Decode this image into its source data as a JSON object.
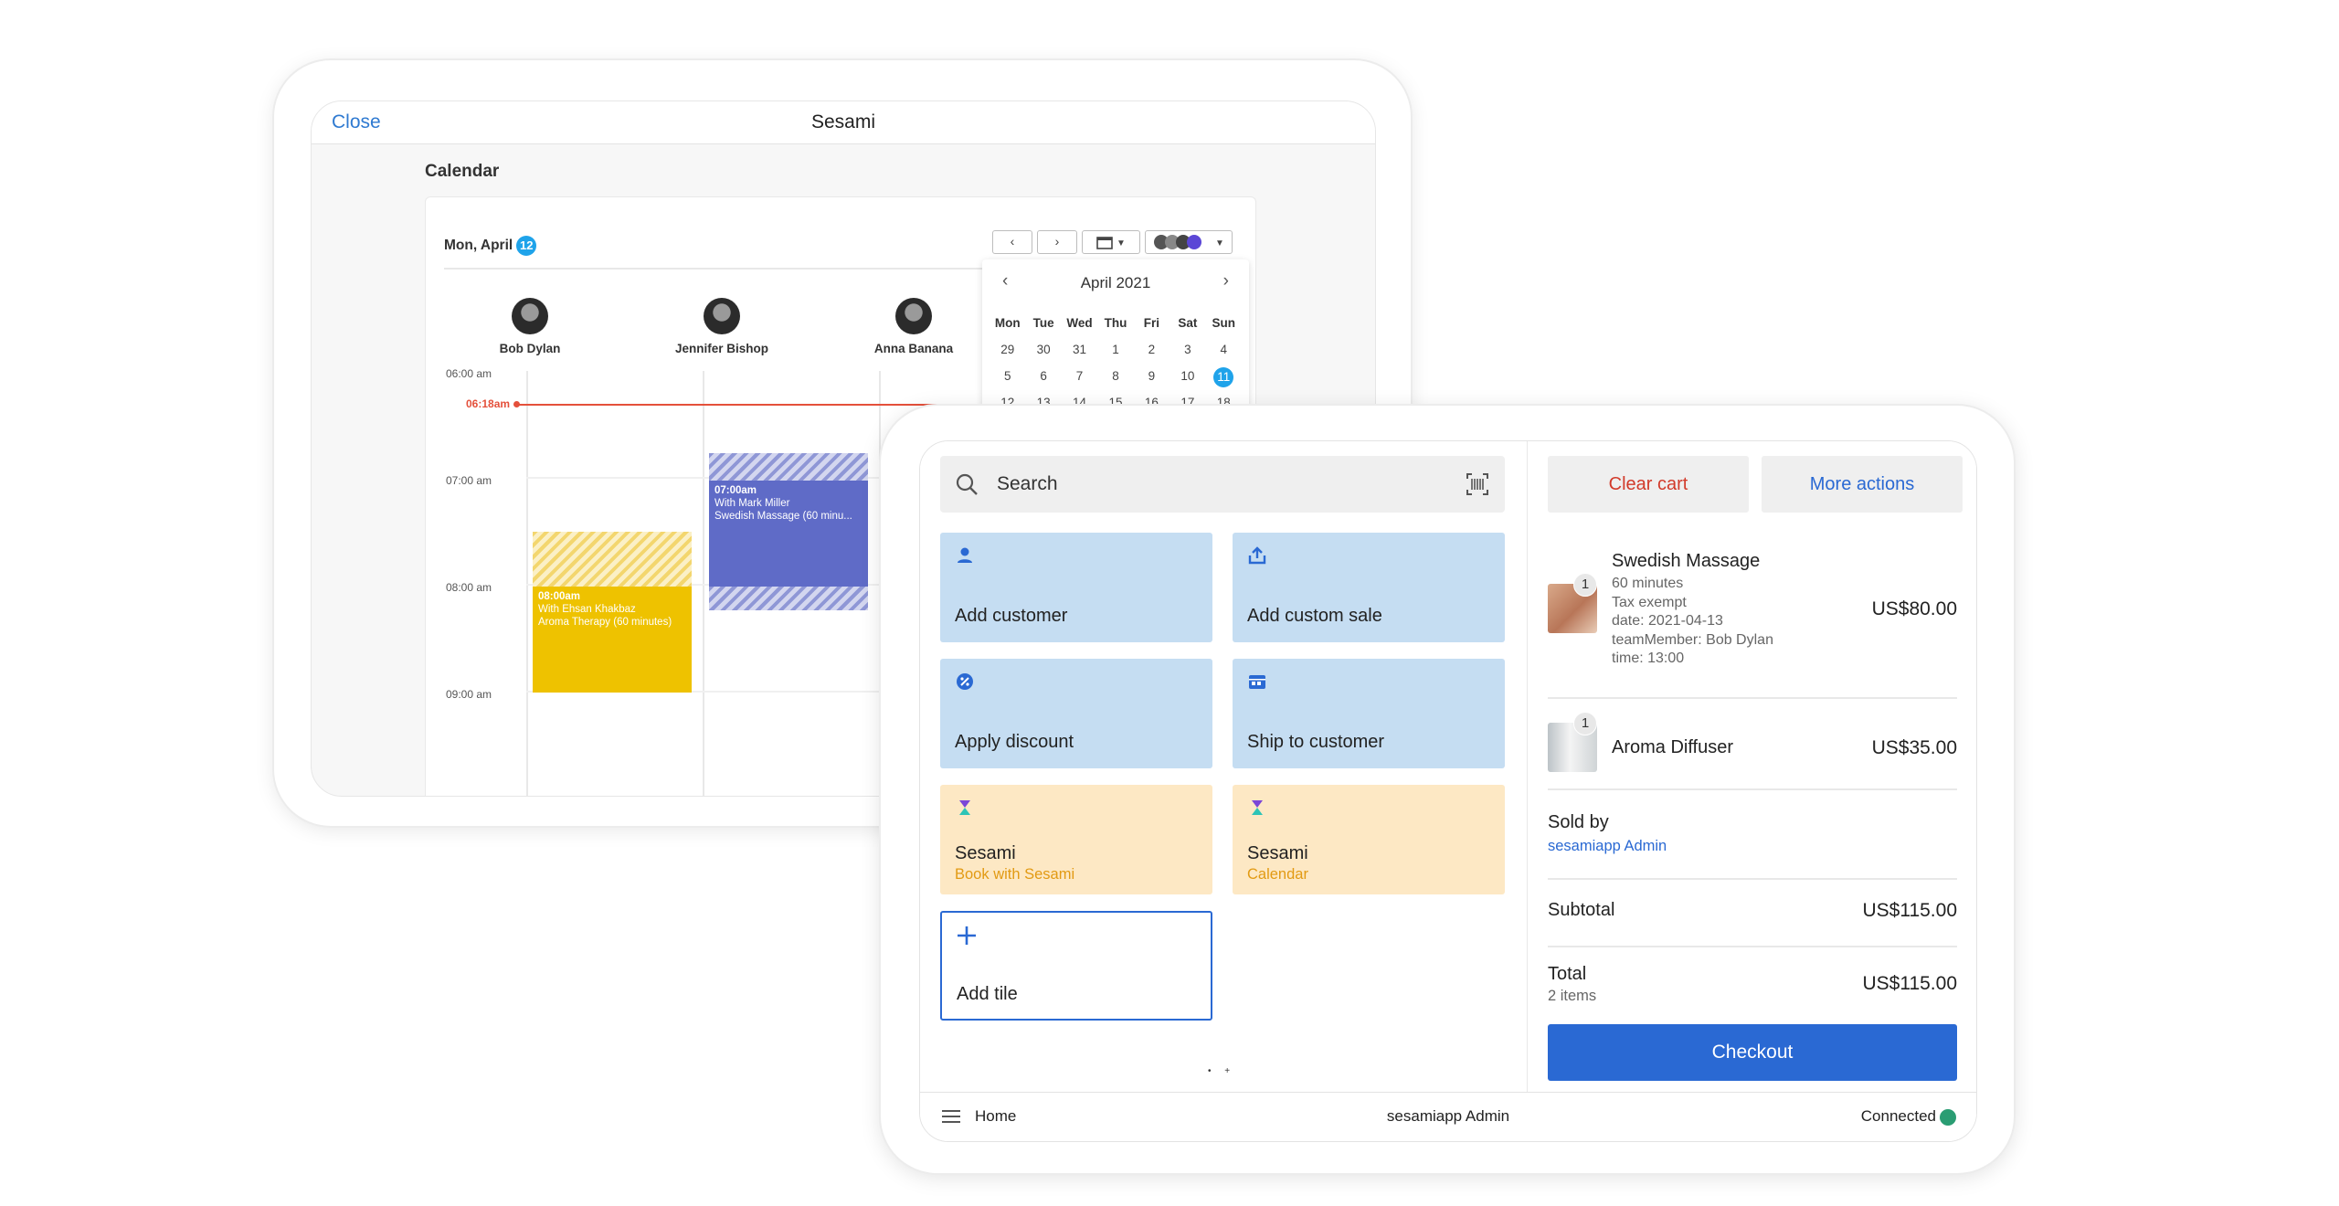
{
  "calendar_app": {
    "close_label": "Close",
    "title": "Sesami",
    "heading": "Calendar",
    "date_label": "Mon, April",
    "date_badge": "12",
    "staff": [
      {
        "name": "Bob Dylan"
      },
      {
        "name": "Jennifer Bishop"
      },
      {
        "name": "Anna Banana"
      }
    ],
    "times": [
      "06:00 am",
      "07:00 am",
      "08:00 am",
      "09:00 am"
    ],
    "now_time": "06:18am",
    "appointments": [
      {
        "time": "08:00am",
        "with": "With Ehsan Khakbaz",
        "service": "Aroma Therapy (60 minutes)",
        "color": "#eec200"
      },
      {
        "time": "07:00am",
        "with": "With Mark Miller",
        "service": "Swedish Massage (60 minu...",
        "color": "#5f6bc7"
      }
    ],
    "mini_calendar": {
      "month": "April 2021",
      "weekdays": [
        "Mon",
        "Tue",
        "Wed",
        "Thu",
        "Fri",
        "Sat",
        "Sun"
      ],
      "days": [
        "29",
        "30",
        "31",
        "1",
        "2",
        "3",
        "4",
        "5",
        "6",
        "7",
        "8",
        "9",
        "10",
        "11",
        "12",
        "13",
        "14",
        "15",
        "16",
        "17",
        "18"
      ],
      "selected": "11"
    },
    "accent": "#1fa3ea",
    "now_color": "#e4503b"
  },
  "pos": {
    "search": {
      "placeholder": "Search"
    },
    "tiles": [
      {
        "label": "Add customer",
        "icon": "person-icon"
      },
      {
        "label": "Add custom sale",
        "icon": "upload-icon"
      },
      {
        "label": "Apply discount",
        "icon": "discount-icon"
      },
      {
        "label": "Ship to customer",
        "icon": "ship-icon"
      },
      {
        "label": "Sesami",
        "sub": "Book with Sesami",
        "icon": "sesami-logo-icon"
      },
      {
        "label": "Sesami",
        "sub": "Calendar",
        "icon": "sesami-logo-icon"
      },
      {
        "label": "Add tile",
        "icon": "plus-icon"
      }
    ],
    "pager": "• +",
    "actions": {
      "clear_cart": "Clear cart",
      "more_actions": "More actions"
    },
    "cart": [
      {
        "name": "Swedish Massage",
        "qty": "1",
        "details": [
          "60 minutes",
          "Tax exempt",
          "date: 2021-04-13",
          "teamMember: Bob Dylan",
          "time: 13:00"
        ],
        "price": "US$80.00"
      },
      {
        "name": "Aroma Diffuser",
        "qty": "1",
        "details": [],
        "price": "US$35.00"
      }
    ],
    "sold_by": {
      "label": "Sold by",
      "value": "sesamiapp Admin"
    },
    "subtotal": {
      "label": "Subtotal",
      "value": "US$115.00"
    },
    "total": {
      "label": "Total",
      "items": "2 items",
      "value": "US$115.00"
    },
    "checkout_label": "Checkout",
    "footer": {
      "home": "Home",
      "user": "sesamiapp Admin",
      "status": "Connected"
    },
    "colors": {
      "primary": "#2a69d3",
      "danger": "#d23a2a",
      "tile_blue": "#c5ddf2",
      "tile_orange": "#fde8c4",
      "connected": "#2a9d73"
    }
  }
}
